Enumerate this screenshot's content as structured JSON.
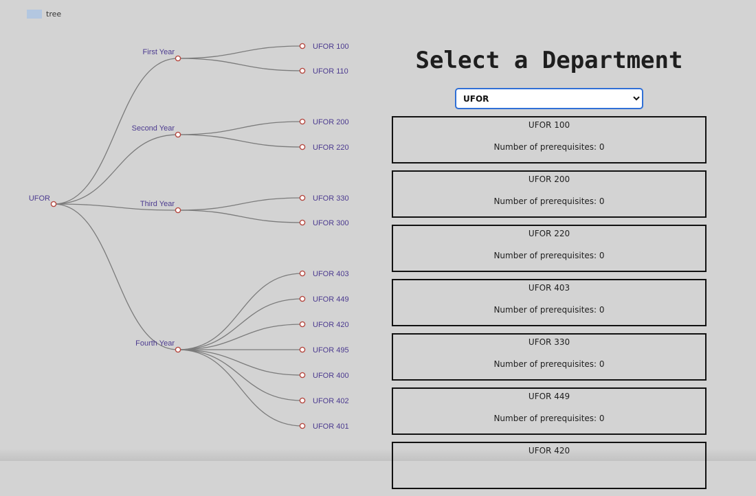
{
  "legend": {
    "label": "tree",
    "color": "#b3c7e0"
  },
  "tree": {
    "root": "UFOR",
    "groups": [
      {
        "label": "First Year",
        "children": [
          "UFOR 100",
          "UFOR 110"
        ]
      },
      {
        "label": "Second Year",
        "children": [
          "UFOR 200",
          "UFOR 220"
        ]
      },
      {
        "label": "Third Year",
        "children": [
          "UFOR 330",
          "UFOR 300"
        ]
      },
      {
        "label": "Fourth Year",
        "children": [
          "UFOR 403",
          "UFOR 449",
          "UFOR 420",
          "UFOR 495",
          "UFOR 400",
          "UFOR 402",
          "UFOR 401"
        ]
      }
    ]
  },
  "panel": {
    "title": "Select a Department",
    "select": {
      "selected": "UFOR",
      "options": [
        "UFOR"
      ]
    }
  },
  "courses": [
    {
      "code": "UFOR 100",
      "prereq": "Number of prerequisites: 0"
    },
    {
      "code": "UFOR 200",
      "prereq": "Number of prerequisites: 0"
    },
    {
      "code": "UFOR 220",
      "prereq": "Number of prerequisites: 0"
    },
    {
      "code": "UFOR 403",
      "prereq": "Number of prerequisites: 0"
    },
    {
      "code": "UFOR 330",
      "prereq": "Number of prerequisites: 0"
    },
    {
      "code": "UFOR 449",
      "prereq": "Number of prerequisites: 0"
    },
    {
      "code": "UFOR 420",
      "prereq": ""
    }
  ],
  "colors": {
    "link": "#7b7b7b",
    "node_stroke": "#b4473f",
    "node_text": "#4b3a8f",
    "select_border": "#2f6fd6"
  }
}
